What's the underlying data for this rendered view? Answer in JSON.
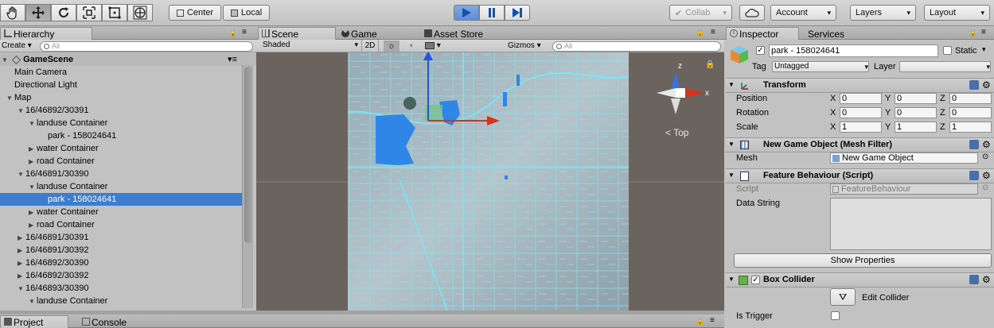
{
  "toolbar": {
    "tools": [
      "hand-tool",
      "move-tool",
      "rotate-tool",
      "scale-tool",
      "rect-tool",
      "transform-tool"
    ],
    "pivot_label": "Center",
    "space_label": "Local",
    "collab_label": "Collab",
    "account_label": "Account",
    "layers_label": "Layers",
    "layout_label": "Layout"
  },
  "hierarchy": {
    "tab_label": "Hierarchy",
    "create_label": "Create",
    "search_placeholder": "All",
    "scene_name": "GameScene",
    "items": [
      {
        "label": "Main Camera",
        "indent": 0,
        "arrow": ""
      },
      {
        "label": "Directional Light",
        "indent": 0,
        "arrow": ""
      },
      {
        "label": "Map",
        "indent": 0,
        "arrow": "▼"
      },
      {
        "label": "16/46892/30391",
        "indent": 1,
        "arrow": "▼"
      },
      {
        "label": "landuse Container",
        "indent": 2,
        "arrow": "▼"
      },
      {
        "label": "park - 158024641",
        "indent": 3,
        "arrow": ""
      },
      {
        "label": "water Container",
        "indent": 2,
        "arrow": "▶"
      },
      {
        "label": "road Container",
        "indent": 2,
        "arrow": "▶"
      },
      {
        "label": "16/46891/30390",
        "indent": 1,
        "arrow": "▼"
      },
      {
        "label": "landuse Container",
        "indent": 2,
        "arrow": "▼"
      },
      {
        "label": "park - 158024641",
        "indent": 3,
        "arrow": "",
        "selected": true
      },
      {
        "label": "water Container",
        "indent": 2,
        "arrow": "▶"
      },
      {
        "label": "road Container",
        "indent": 2,
        "arrow": "▶"
      },
      {
        "label": "16/46891/30391",
        "indent": 1,
        "arrow": "▶"
      },
      {
        "label": "16/46891/30392",
        "indent": 1,
        "arrow": "▶"
      },
      {
        "label": "16/46892/30390",
        "indent": 1,
        "arrow": "▶"
      },
      {
        "label": "16/46892/30392",
        "indent": 1,
        "arrow": "▶"
      },
      {
        "label": "16/46893/30390",
        "indent": 1,
        "arrow": "▼"
      },
      {
        "label": "landuse Container",
        "indent": 2,
        "arrow": "▼"
      }
    ]
  },
  "scene": {
    "tabs": [
      "Scene",
      "Game",
      "Asset Store"
    ],
    "shading_mode": "Shaded",
    "mode_2d": "2D",
    "gizmos_label": "Gizmos",
    "search_placeholder": "All",
    "view_label": "Top",
    "axis_labels": {
      "x": "x",
      "y": "y",
      "z": "z"
    }
  },
  "inspector": {
    "tabs": [
      "Inspector",
      "Services"
    ],
    "object_name": "park - 158024641",
    "static_label": "Static",
    "tag_label": "Tag",
    "tag_value": "Untagged",
    "layer_label": "Layer",
    "layer_value": "",
    "transform": {
      "title": "Transform",
      "rows": [
        {
          "label": "Position",
          "x": "0",
          "y": "0",
          "z": "0"
        },
        {
          "label": "Rotation",
          "x": "0",
          "y": "0",
          "z": "0"
        },
        {
          "label": "Scale",
          "x": "1",
          "y": "1",
          "z": "1"
        }
      ],
      "axis": [
        "X",
        "Y",
        "Z"
      ]
    },
    "mesh_filter": {
      "title": "New Game Object (Mesh Filter)",
      "mesh_label": "Mesh",
      "mesh_value": "New Game Object"
    },
    "feature_behaviour": {
      "title": "Feature Behaviour (Script)",
      "script_label": "Script",
      "script_value": "FeatureBehaviour",
      "data_label": "Data String",
      "button_label": "Show Properties"
    },
    "box_collider": {
      "title": "Box Collider",
      "edit_label": "Edit Collider",
      "trigger_label": "Is Trigger"
    }
  },
  "bottom": {
    "tabs": [
      "Project",
      "Console"
    ]
  },
  "colors": {
    "selection": "#3e7ccf",
    "play_active": "#5e8ed5",
    "scene_bg": "#6b635d",
    "water": "#2f86e6",
    "roads": "#7fe3f5"
  }
}
